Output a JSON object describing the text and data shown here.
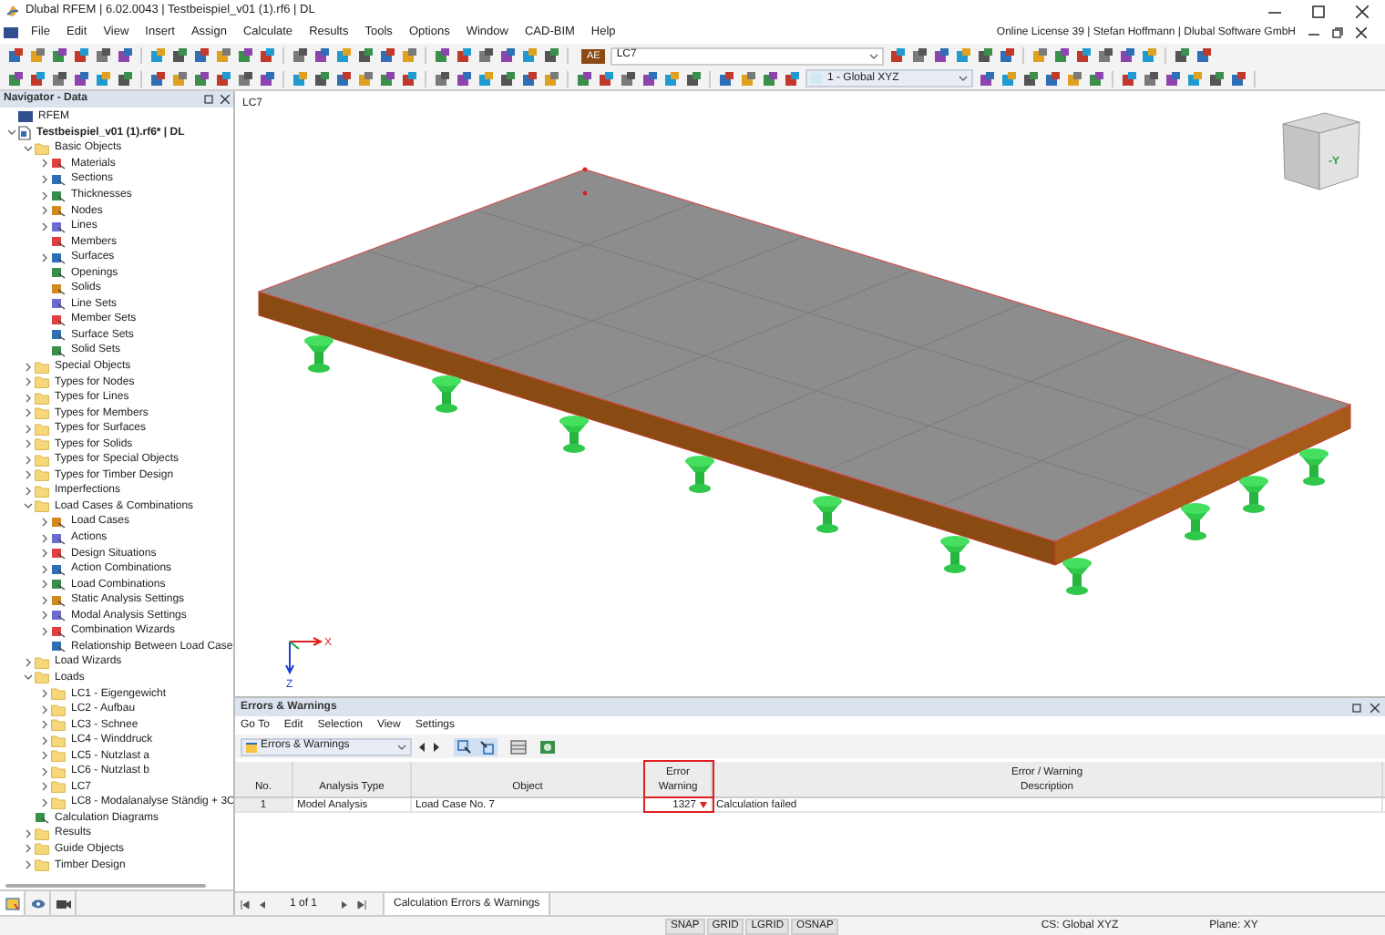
{
  "window": {
    "title": "Dlubal RFEM | 6.02.0043 | Testbeispiel_v01 (1).rf6 | DL"
  },
  "menu": [
    "File",
    "Edit",
    "View",
    "Insert",
    "Assign",
    "Calculate",
    "Results",
    "Tools",
    "Options",
    "Window",
    "CAD-BIM",
    "Help"
  ],
  "license": "Online License 39 | Stefan Hoffmann | Dlubal Software GmbH",
  "toolbar": {
    "load_case_badge": "AE",
    "load_case": "LC7",
    "coordinate_system": "1 - Global XYZ"
  },
  "navigator": {
    "title": "Navigator - Data",
    "tree": [
      {
        "label": "RFEM",
        "kind": "root"
      },
      {
        "label": "Testbeispiel_v01 (1).rf6* | DL",
        "kind": "file",
        "expanded": true,
        "children": [
          {
            "label": "Basic Objects",
            "kind": "folder",
            "expanded": true,
            "children": [
              {
                "label": "Materials",
                "kind": "object",
                "expanded": false
              },
              {
                "label": "Sections",
                "kind": "object",
                "expanded": false
              },
              {
                "label": "Thicknesses",
                "kind": "object",
                "expanded": false
              },
              {
                "label": "Nodes",
                "kind": "object",
                "expanded": false
              },
              {
                "label": "Lines",
                "kind": "object",
                "expanded": false
              },
              {
                "label": "Members",
                "kind": "object"
              },
              {
                "label": "Surfaces",
                "kind": "object",
                "expanded": false
              },
              {
                "label": "Openings",
                "kind": "object"
              },
              {
                "label": "Solids",
                "kind": "object"
              },
              {
                "label": "Line Sets",
                "kind": "object"
              },
              {
                "label": "Member Sets",
                "kind": "object"
              },
              {
                "label": "Surface Sets",
                "kind": "object"
              },
              {
                "label": "Solid Sets",
                "kind": "object"
              }
            ]
          },
          {
            "label": "Special Objects",
            "kind": "folder",
            "expanded": false
          },
          {
            "label": "Types for Nodes",
            "kind": "folder",
            "expanded": false
          },
          {
            "label": "Types for Lines",
            "kind": "folder",
            "expanded": false
          },
          {
            "label": "Types for Members",
            "kind": "folder",
            "expanded": false
          },
          {
            "label": "Types for Surfaces",
            "kind": "folder",
            "expanded": false
          },
          {
            "label": "Types for Solids",
            "kind": "folder",
            "expanded": false
          },
          {
            "label": "Types for Special Objects",
            "kind": "folder",
            "expanded": false
          },
          {
            "label": "Types for Timber Design",
            "kind": "folder",
            "expanded": false
          },
          {
            "label": "Imperfections",
            "kind": "folder",
            "expanded": false
          },
          {
            "label": "Load Cases & Combinations",
            "kind": "folder",
            "expanded": true,
            "children": [
              {
                "label": "Load Cases",
                "kind": "object",
                "expanded": false
              },
              {
                "label": "Actions",
                "kind": "object",
                "expanded": false
              },
              {
                "label": "Design Situations",
                "kind": "object",
                "expanded": false
              },
              {
                "label": "Action Combinations",
                "kind": "object",
                "expanded": false
              },
              {
                "label": "Load Combinations",
                "kind": "object",
                "expanded": false
              },
              {
                "label": "Static Analysis Settings",
                "kind": "object",
                "expanded": false
              },
              {
                "label": "Modal Analysis Settings",
                "kind": "object",
                "expanded": false
              },
              {
                "label": "Combination Wizards",
                "kind": "object",
                "expanded": false
              },
              {
                "label": "Relationship Between Load Case",
                "kind": "object"
              }
            ]
          },
          {
            "label": "Load Wizards",
            "kind": "folder",
            "expanded": false
          },
          {
            "label": "Loads",
            "kind": "folder",
            "expanded": true,
            "children": [
              {
                "label": "LC1 - Eigengewicht",
                "kind": "folder",
                "expanded": false
              },
              {
                "label": "LC2 - Aufbau",
                "kind": "folder",
                "expanded": false
              },
              {
                "label": "LC3 - Schnee",
                "kind": "folder",
                "expanded": false
              },
              {
                "label": "LC4 - Winddruck",
                "kind": "folder",
                "expanded": false
              },
              {
                "label": "LC5 - Nutzlast a",
                "kind": "folder",
                "expanded": false
              },
              {
                "label": "LC6 - Nutzlast b",
                "kind": "folder",
                "expanded": false
              },
              {
                "label": "LC7",
                "kind": "folder",
                "expanded": false
              },
              {
                "label": "LC8 - Modalanalyse Ständig + 3C",
                "kind": "folder",
                "expanded": false
              }
            ]
          },
          {
            "label": "Calculation Diagrams",
            "kind": "object"
          },
          {
            "label": "Results",
            "kind": "folder",
            "expanded": false
          },
          {
            "label": "Guide Objects",
            "kind": "folder",
            "expanded": false
          },
          {
            "label": "Timber Design",
            "kind": "folder",
            "expanded": false
          }
        ]
      }
    ]
  },
  "viewport": {
    "label": "LC7",
    "view_cube_label": "-Y",
    "axis_labels": [
      "X",
      "Z"
    ]
  },
  "errors_panel": {
    "title": "Errors & Warnings",
    "menu": [
      "Go To",
      "Edit",
      "Selection",
      "View",
      "Settings"
    ],
    "view_selector": "Errors & Warnings",
    "columns": [
      {
        "bottom": "No.",
        "highlighted": false
      },
      {
        "bottom": "Analysis Type",
        "highlighted": false
      },
      {
        "bottom": "Object",
        "highlighted": false
      },
      {
        "top": "Error",
        "bottom": "Warning",
        "highlighted": true
      },
      {
        "top": "Error / Warning",
        "bottom": "Description",
        "highlighted": false
      }
    ],
    "rows": [
      {
        "cells": [
          "1",
          "Model Analysis",
          "Load Case No. 7",
          "1327",
          "Calculation failed"
        ],
        "kind": "error"
      }
    ],
    "pager": "1 of 1",
    "tabs": [
      {
        "label": "Calculation Errors & Warnings",
        "selected": true
      }
    ]
  },
  "status_bar": {
    "toggles": [
      "SNAP",
      "GRID",
      "LGRID",
      "OSNAP"
    ],
    "cs": "CS: Global XYZ",
    "plane": "Plane: XY"
  }
}
